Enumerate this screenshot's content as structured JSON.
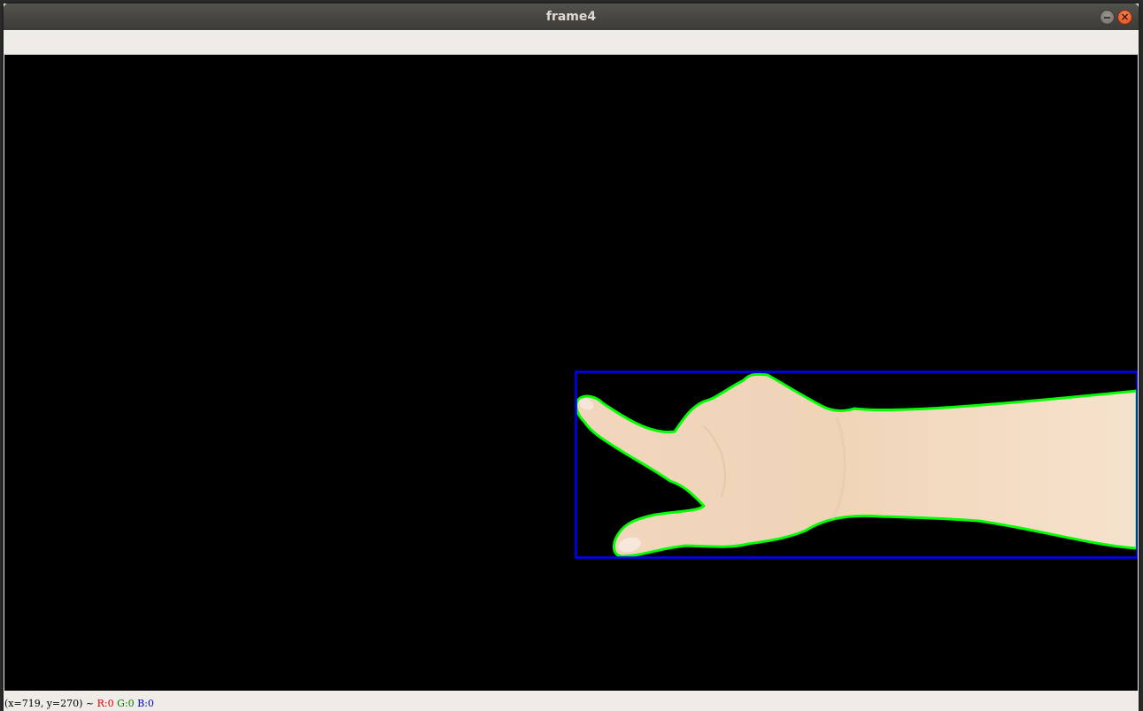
{
  "window": {
    "title": "frame4",
    "minimize_symbol": "",
    "close_symbol": "×"
  },
  "image": {
    "description_icon": "hand-contour-image",
    "background_color": "#000000",
    "bounding_box_color": "#0000ff",
    "contour_color": "#00ff00",
    "skin_color": "#f2d9bf"
  },
  "statusbar": {
    "coords": "(x=719, y=270) ~",
    "r": "R:0",
    "g": "G:0",
    "b": "B:0"
  }
}
